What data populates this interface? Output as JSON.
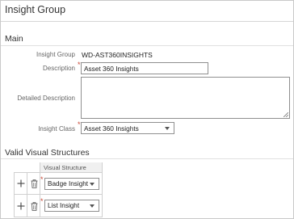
{
  "page": {
    "title": "Insight Group"
  },
  "main": {
    "header": "Main",
    "fields": {
      "insight_group_label": "Insight Group",
      "insight_group_value": "WD-AST360INSIGHTS",
      "description_label": "Description",
      "description_value": "Asset 360 Insights",
      "detailed_description_label": "Detailed Description",
      "detailed_description_value": "",
      "insight_class_label": "Insight Class",
      "insight_class_value": "Asset 360 Insights"
    }
  },
  "valid_visual_structures": {
    "header": "Valid Visual Structures",
    "column_header": "Visual Structure",
    "rows": [
      {
        "visual_structure": "Badge Insight"
      },
      {
        "visual_structure": "List Insight"
      }
    ]
  },
  "colors": {
    "required_marker": "#c74634",
    "border": "#8f8f8f"
  },
  "icons": [
    "add-row-icon",
    "delete-row-icon",
    "chevron-down-icon",
    "resize-grip-icon"
  ]
}
